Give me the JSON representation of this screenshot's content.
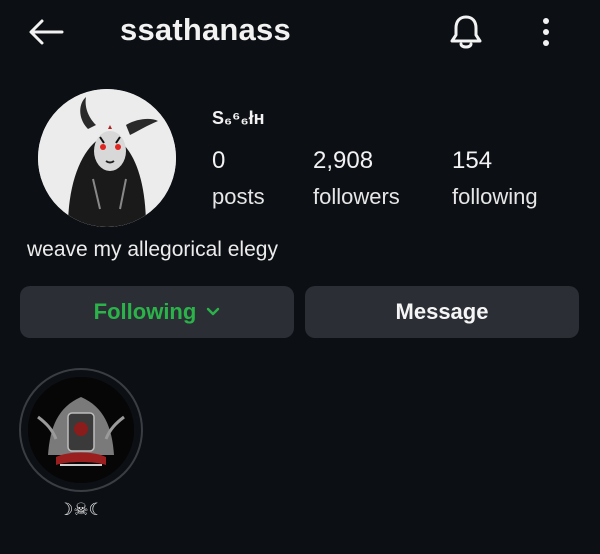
{
  "header": {
    "username": "ssathanass",
    "back_icon": "arrow-left-icon",
    "notification_icon": "bell-icon",
    "more_icon": "more-vertical-icon"
  },
  "profile": {
    "display_name": "S₆⁶₆łн",
    "stats": {
      "posts": {
        "value": "0",
        "label": "posts"
      },
      "followers": {
        "value": "2,908",
        "label": "followers"
      },
      "following": {
        "value": "154",
        "label": "following"
      }
    },
    "bio": "weave my allegorical elegy"
  },
  "actions": {
    "following_label": "Following",
    "message_label": "Message",
    "following_color": "#2bb34a"
  },
  "highlights": [
    {
      "label": "☽☠︎☾"
    }
  ]
}
